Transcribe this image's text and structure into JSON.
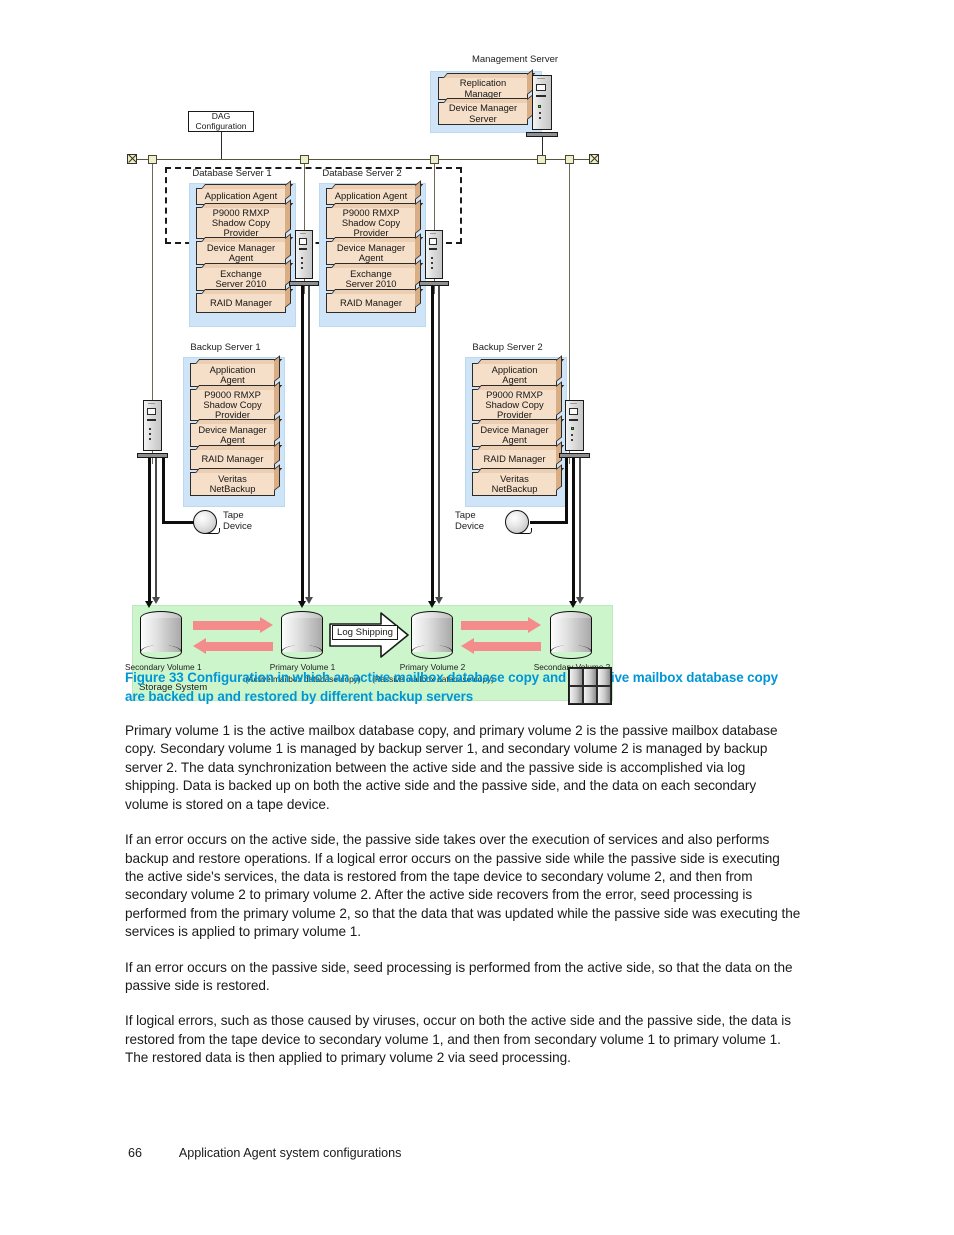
{
  "figure": {
    "management_server": {
      "label": "Management Server",
      "components": [
        "Replication\nManager",
        "Device Manager\nServer"
      ]
    },
    "dag_configuration": "DAG\nConfiguration",
    "database_server_1": {
      "label": "Database Server 1",
      "components": [
        "Application Agent",
        "P9000 RMXP\nShadow Copy\nProvider",
        "Device Manager\nAgent",
        "Exchange\nServer 2010",
        "RAID Manager"
      ]
    },
    "database_server_2": {
      "label": "Database Server 2",
      "components": [
        "Application Agent",
        "P9000 RMXP\nShadow Copy\nProvider",
        "Device Manager\nAgent",
        "Exchange\nServer 2010",
        "RAID Manager"
      ]
    },
    "backup_server_1": {
      "label": "Backup Server 1",
      "components": [
        "Application\nAgent",
        "P9000 RMXP\nShadow Copy\nProvider",
        "Device Manager\nAgent",
        "RAID Manager",
        "Veritas\nNetBackup"
      ]
    },
    "backup_server_2": {
      "label": "Backup Server 2",
      "components": [
        "Application\nAgent",
        "P9000 RMXP\nShadow Copy\nProvider",
        "Device Manager\nAgent",
        "RAID Manager",
        "Veritas\nNetBackup"
      ]
    },
    "tape_device_1": "Tape\nDevice",
    "tape_device_2": "Tape\nDevice",
    "storage_system": {
      "label": "Storage System",
      "volumes": [
        {
          "name": "Secondary Volume 1",
          "sub": ""
        },
        {
          "name": "Primary Volume 1",
          "sub": "(Active mailbox database copy)"
        },
        {
          "name": "Primary Volume 2",
          "sub": "(Passive mailbox database copy)"
        },
        {
          "name": "Secondary Volume 2",
          "sub": ""
        }
      ],
      "log_shipping": "Log Shipping"
    },
    "colors": {
      "component_fill": "#f6dfc8",
      "server_group_fill": "#cfe4f7",
      "storage_fill": "#ccf5cc",
      "sync_arrow": "#f48c8c",
      "bus_node": "#eeeecc"
    }
  },
  "caption": "Figure 33 Configuration in which an active mailbox database copy and a passive mailbox database copy are backed up and restored by different backup servers",
  "paragraphs": [
    "Primary volume 1 is the active mailbox database copy, and primary volume 2 is the passive mailbox database copy. Secondary volume 1 is managed by backup server 1, and secondary volume 2 is managed by backup server 2. The data synchronization between the active side and the passive side is accomplished via log shipping. Data is backed up on both the active side and the passive side, and the data on each secondary volume is stored on a tape device.",
    "If an error occurs on the active side, the passive side takes over the execution of services and also performs backup and restore operations. If a logical error occurs on the passive side while the passive side is executing the active side's services, the data is restored from the tape device to secondary volume 2, and then from secondary volume 2 to primary volume 2. After the active side recovers from the error, seed processing is performed from the primary volume 2, so that the data that was updated while the passive side was executing the services is applied to primary volume 1.",
    "If an error occurs on the passive side, seed processing is performed from the active side, so that the data on the passive side is restored.",
    "If logical errors, such as those caused by viruses, occur on both the active side and the passive side, the data is restored from the tape device to secondary volume 1, and then from secondary volume 1 to primary volume 1. The restored data is then applied to primary volume 2 via seed processing."
  ],
  "footer": {
    "page_number": "66",
    "section_title": "Application Agent system configurations"
  }
}
